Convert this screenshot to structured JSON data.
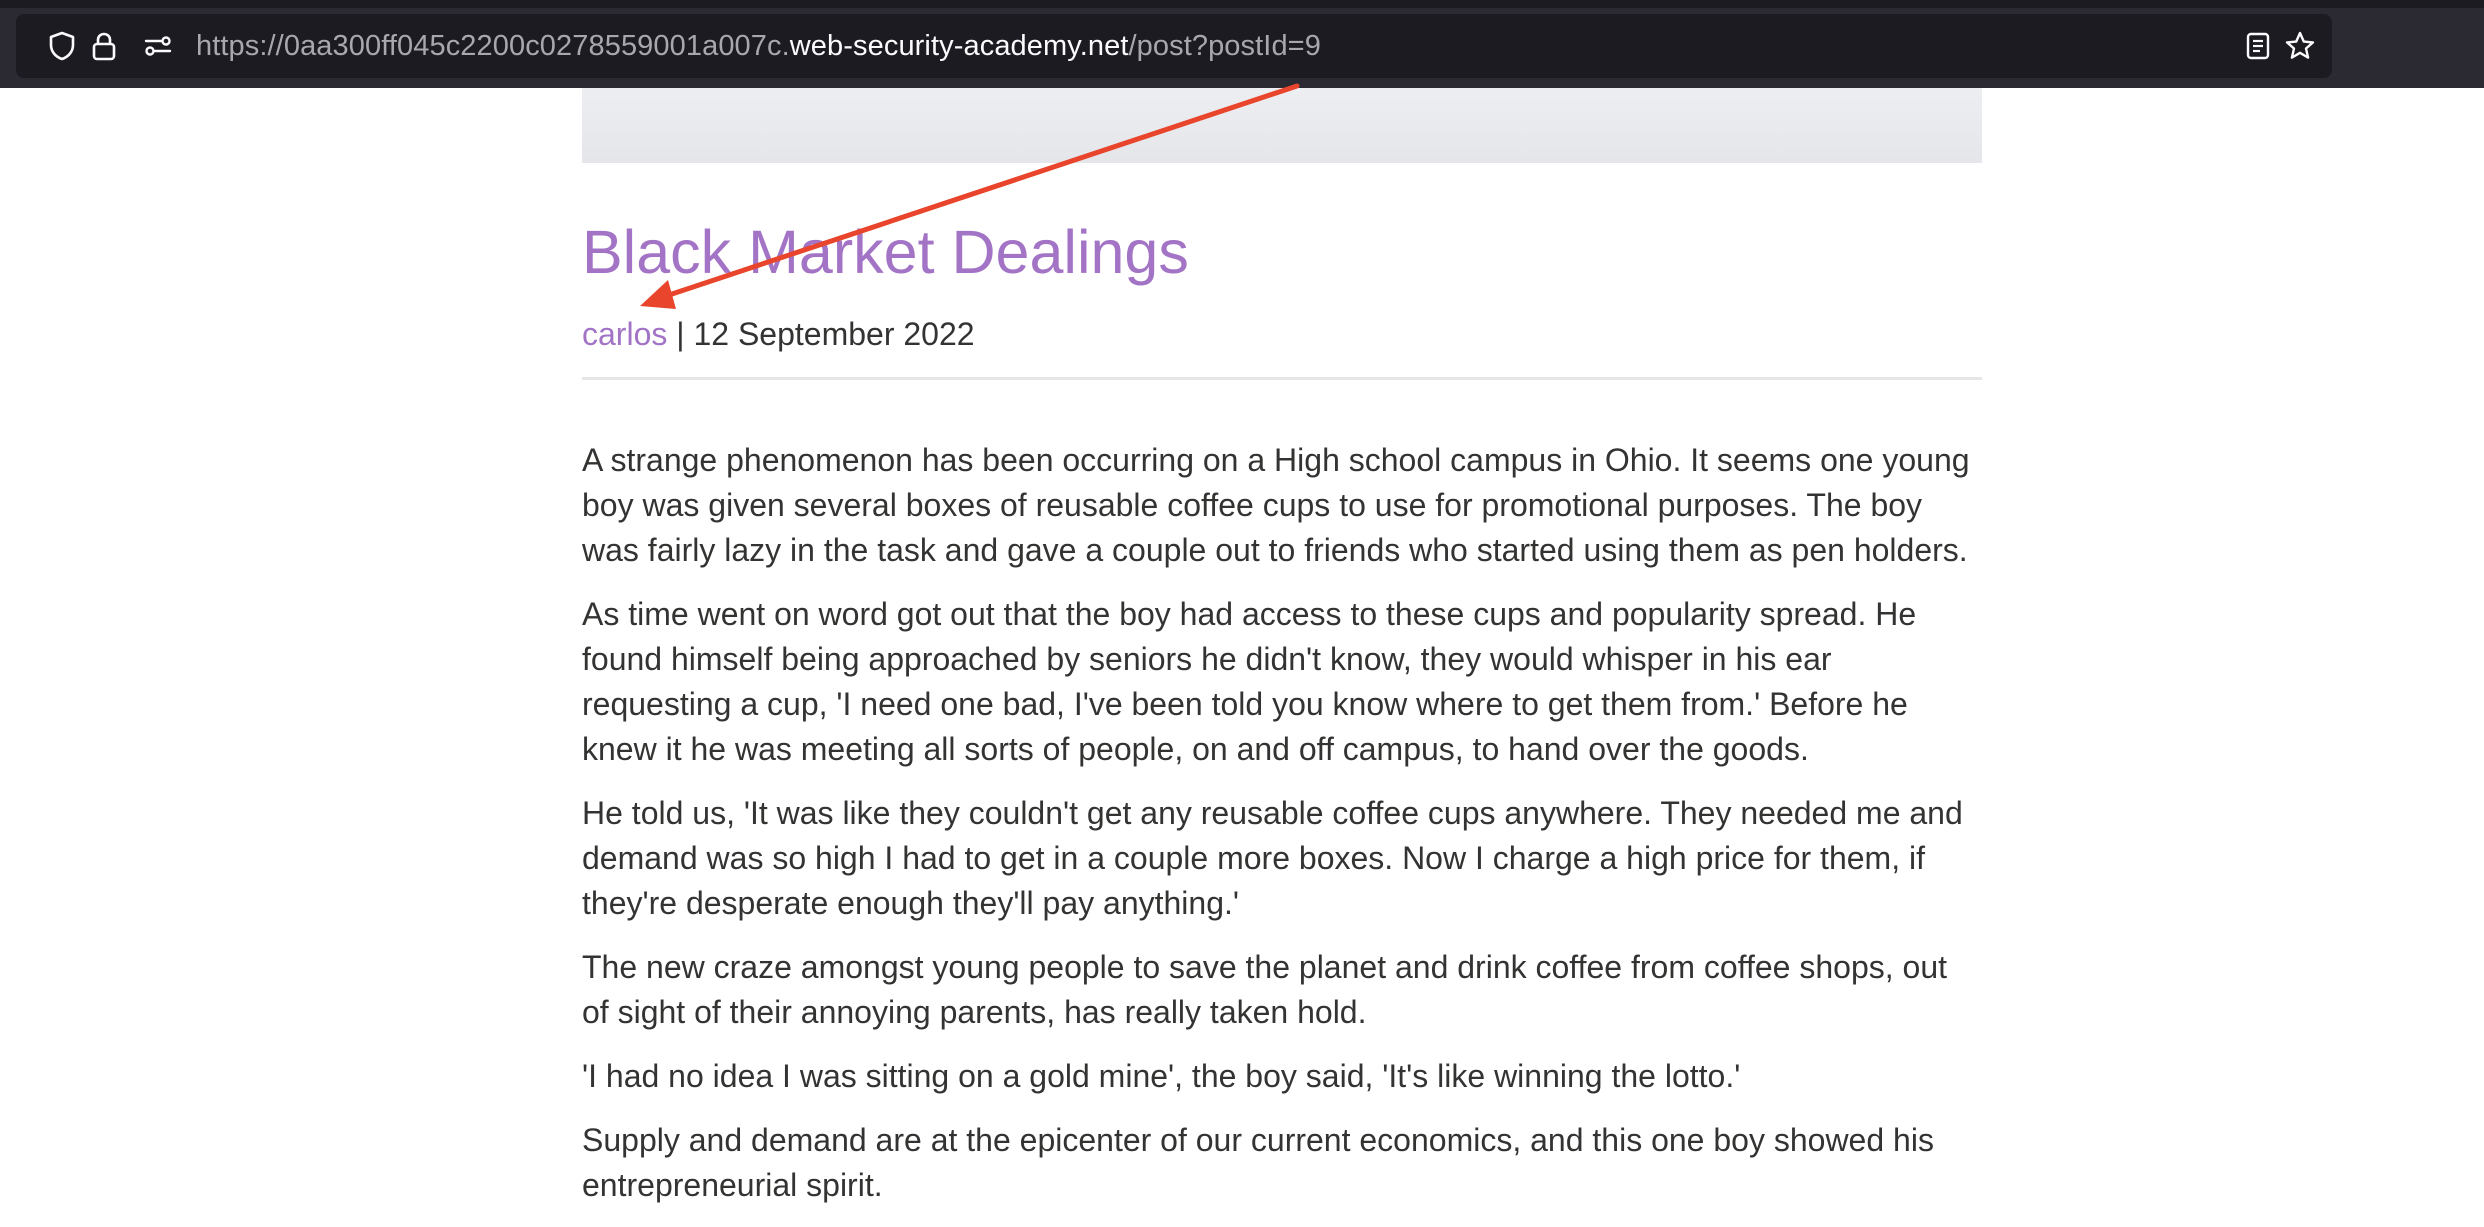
{
  "browser": {
    "url_prefix": "https://0aa300ff045c2200c0278559001a007c.",
    "url_domain": "web-security-academy.net",
    "url_path": "/post?postId=9",
    "icons": [
      "shield-icon",
      "lock-icon",
      "tracking-settings-icon",
      "reader-view-icon",
      "bookmark-star-icon"
    ]
  },
  "post": {
    "title": "Black Market Dealings",
    "author": "carlos",
    "separator": " | ",
    "date": "12 September 2022",
    "paragraphs": [
      "A strange phenomenon has been occurring on a High school campus in Ohio. It seems one young boy was given several boxes of reusable coffee cups to use for promotional purposes. The boy was fairly lazy in the task and gave a couple out to friends who started using them as pen holders.",
      "As time went on word got out that the boy had access to these cups and popularity spread. He found himself being approached by seniors he didn't know, they would whisper in his ear requesting a cup, 'I need one bad, I've been told you know where to get them from.' Before he knew it he was meeting all sorts of people, on and off campus, to hand over the goods.",
      "He told us, 'It was like they couldn't get any reusable coffee cups anywhere. They needed me and demand was so high I had to get in a couple more boxes. Now I charge a high price for them, if they're desperate enough they'll pay anything.'",
      "The new craze amongst young people to save the planet and drink coffee from coffee shops, out of sight of their annoying parents, has really taken hold.",
      "'I had no idea I was sitting on a gold mine', the boy said, 'It's like winning the lotto.'",
      "Supply and demand are at the epicenter of our current economics, and this one boy showed his entrepreneurial spirit."
    ]
  },
  "colors": {
    "browser_bar": "#2b2a33",
    "url_field": "#1c1b22",
    "link_purple": "#a374c6",
    "body_text": "#333332",
    "annotation_arrow": "#e8452c"
  }
}
